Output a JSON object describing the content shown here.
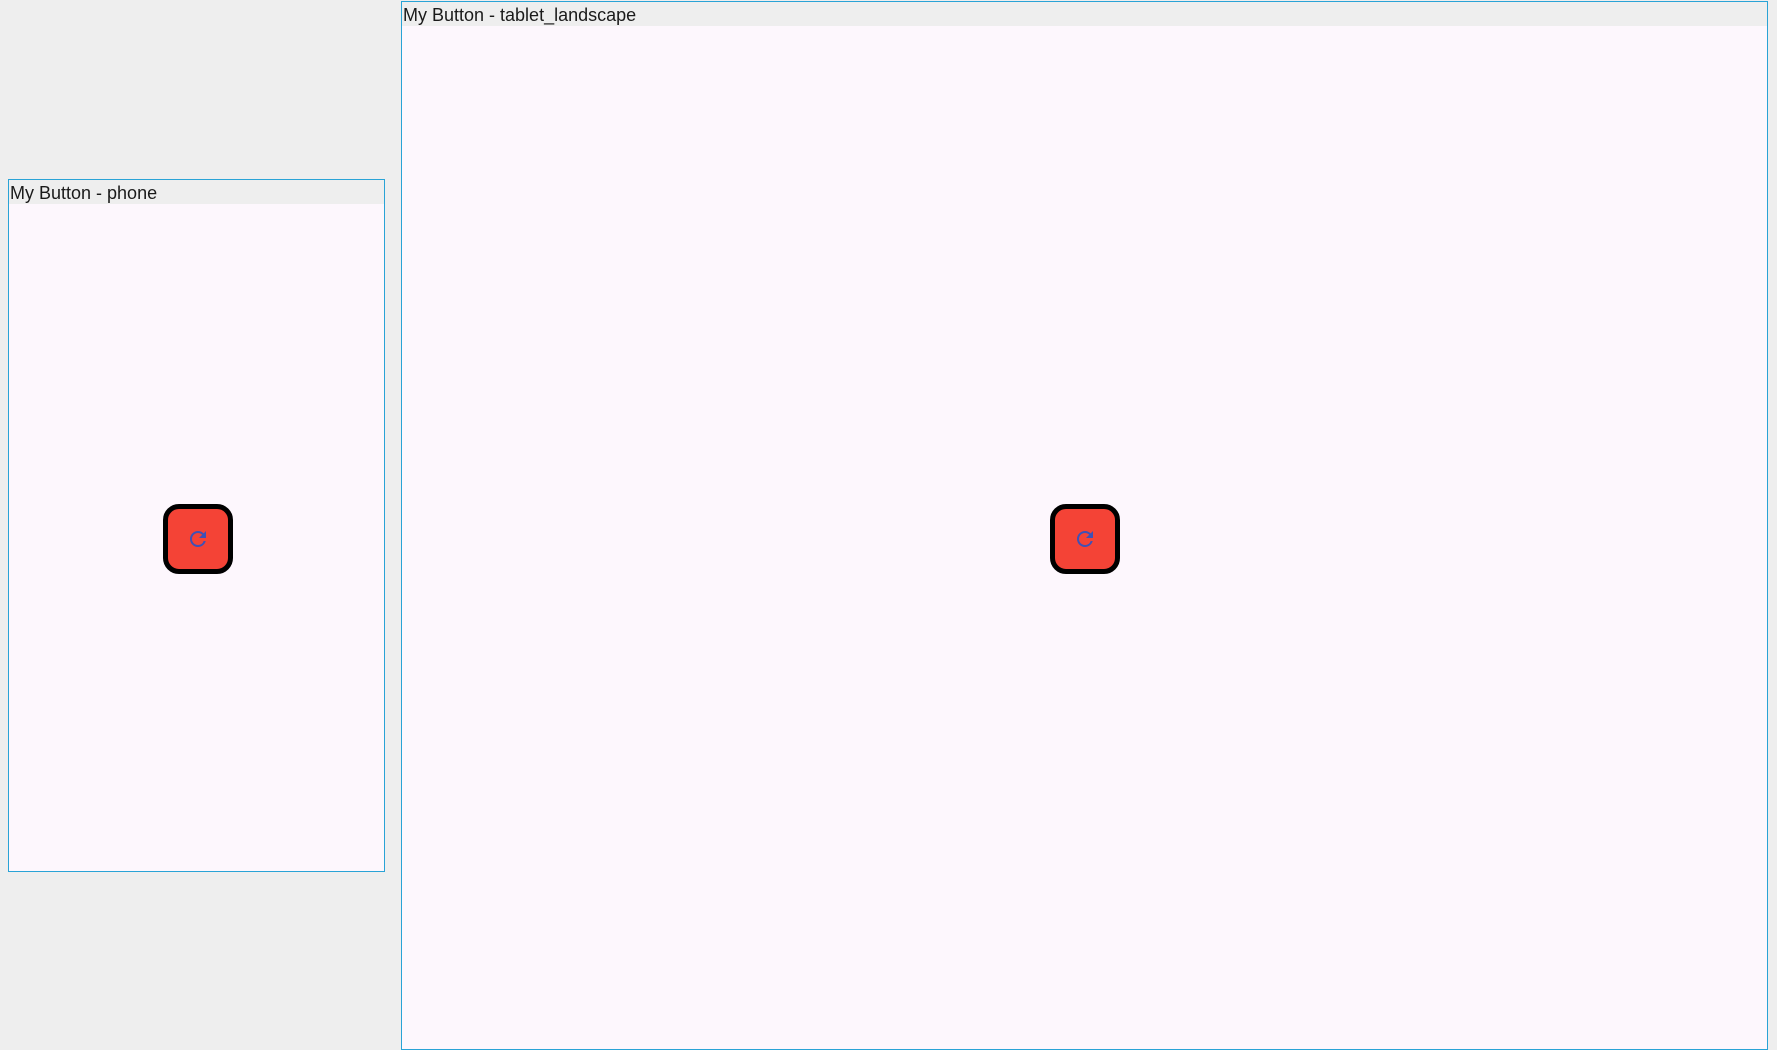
{
  "colors": {
    "background": "#eeeeee",
    "frame_border": "#29a3d6",
    "frame_surface": "#fdf7fd",
    "button_fill": "#f44336",
    "button_border": "#000000",
    "icon_color": "#3f51b5"
  },
  "frames": {
    "phone": {
      "title": "My Button - phone",
      "button": {
        "icon": "refresh-icon"
      }
    },
    "tablet_landscape": {
      "title": "My Button - tablet_landscape",
      "button": {
        "icon": "refresh-icon"
      }
    }
  }
}
